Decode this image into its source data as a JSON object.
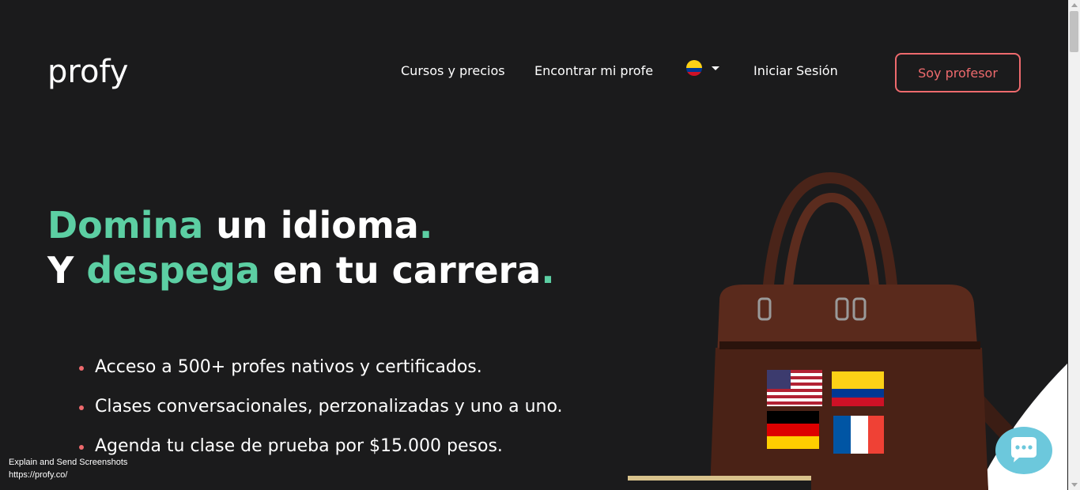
{
  "header": {
    "logo_text": "profy",
    "nav": [
      {
        "label": "Cursos y precios"
      },
      {
        "label": "Encontrar mi profe"
      },
      {
        "label": "Iniciar Sesión"
      }
    ],
    "language_flag": "colombia-flag-icon",
    "cta_label": "Soy profesor"
  },
  "hero": {
    "line1": {
      "green": "Domina",
      "white": " un idioma",
      "dot": "."
    },
    "line2": {
      "white1": "Y ",
      "green": "despega",
      "white2": " en tu carrera",
      "dot": "."
    },
    "bullets": [
      "Acceso a 500+ profes nativos y certificados.",
      "Clases conversacionales, perzonalizadas y uno a uno.",
      "Agenda tu clase de prueba por $15.000 pesos."
    ]
  },
  "overlay": {
    "title": "Explain and Send Screenshots",
    "url": "https://profy.co/"
  },
  "colors": {
    "background": "#1b1b1c",
    "accent_green": "#5ccfa3",
    "accent_coral": "#ee6a6d",
    "chat": "#6cc8dc"
  }
}
